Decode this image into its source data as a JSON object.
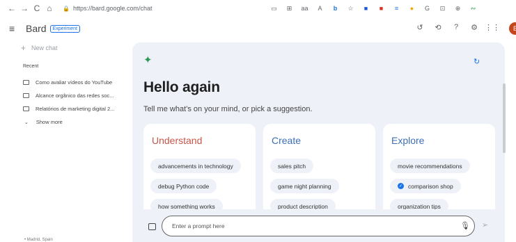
{
  "browser": {
    "url": "https://bard.google.com/chat",
    "back_icon": "←",
    "forward_icon": "→",
    "reload_icon": "C",
    "home_icon": "⌂",
    "lock_icon": "🔒",
    "extensions": [
      "▭",
      "⊞",
      "aа",
      "A",
      "b",
      "☆",
      "■",
      "■",
      "≡",
      "●",
      "G",
      "⊡",
      "⊕",
      "∾"
    ]
  },
  "header": {
    "menu_icon": "≡",
    "brand": "Bard",
    "badge": "Experiment",
    "icons": [
      "↺",
      "⟲",
      "?",
      "⚙",
      "⋮⋮"
    ],
    "avatar_letter": "B"
  },
  "sidebar": {
    "new_chat": "New chat",
    "recent_label": "Recent",
    "recent_items": [
      "Como avaliar vídeos do YouTube",
      "Alcance orgânico das redes soc...",
      "Relatórios de marketing digital 2..."
    ],
    "show_more": "Show more",
    "location": "• Madrid, Spain"
  },
  "main": {
    "sparkle": "✦",
    "refresh": "↻",
    "greeting": "Hello again",
    "subtitle": "Tell me what’s on your mind, or pick a suggestion.",
    "cards": [
      {
        "title": "Understand",
        "color": "#c9564a",
        "chips": [
          "advancements in technology",
          "debug Python code",
          "how something works"
        ]
      },
      {
        "title": "Create",
        "color": "#3c6fb5",
        "chips": [
          "sales pitch",
          "game night planning",
          "product description"
        ]
      },
      {
        "title": "Explore",
        "color": "#3c6fb5",
        "chips": [
          "movie recommendations",
          "comparison shop",
          "organization tips"
        ]
      }
    ],
    "prompt_placeholder": "Enter a prompt here",
    "mic": "🎙",
    "send": "➢"
  }
}
